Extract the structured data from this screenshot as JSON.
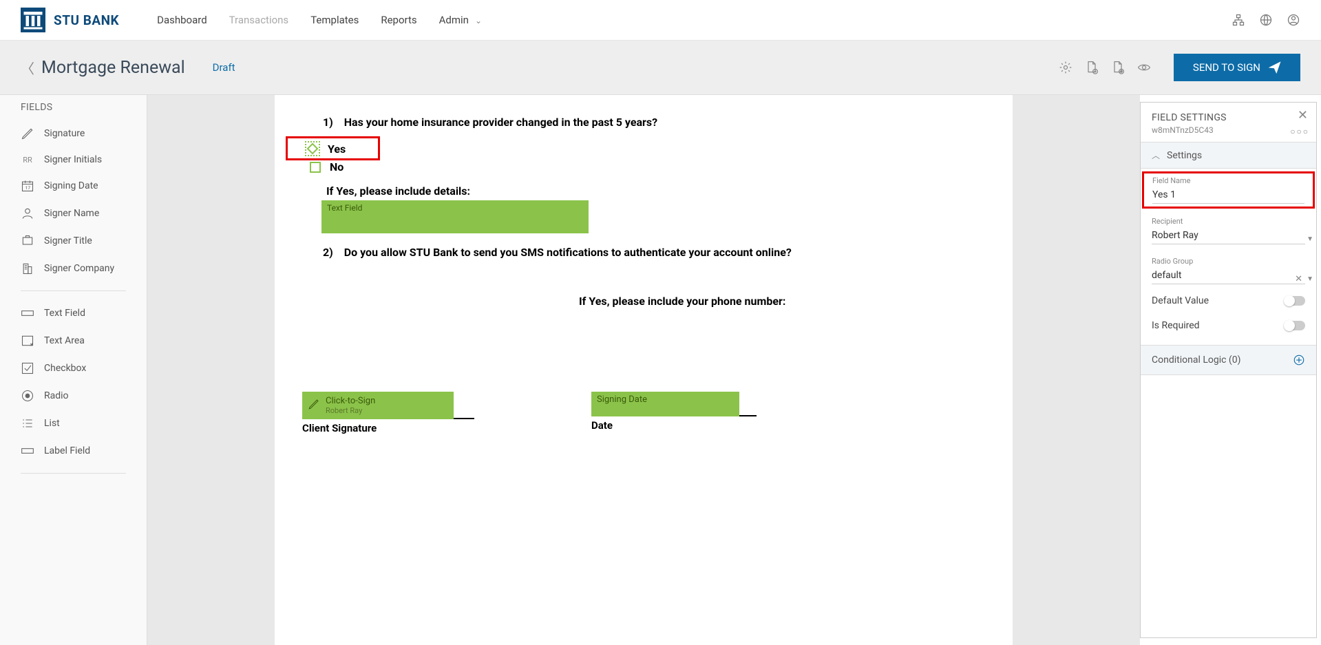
{
  "brand": "STU BANK",
  "nav": {
    "dashboard": "Dashboard",
    "transactions": "Transactions",
    "templates": "Templates",
    "reports": "Reports",
    "admin": "Admin"
  },
  "page": {
    "title": "Mortgage Renewal",
    "status": "Draft",
    "sendButton": "SEND TO SIGN"
  },
  "sidebar": {
    "title": "FIELDS",
    "signature": "Signature",
    "initialsPrefix": "RR",
    "initials": "Signer Initials",
    "signingDate": "Signing Date",
    "signerName": "Signer Name",
    "signerTitle": "Signer Title",
    "signerCompany": "Signer Company",
    "textField": "Text Field",
    "textArea": "Text Area",
    "checkbox": "Checkbox",
    "radio": "Radio",
    "list": "List",
    "labelField": "Label Field"
  },
  "doc": {
    "q1": "1)    Has your home insurance provider changed in the past 5 years?",
    "yes": "Yes",
    "no": "No",
    "ifYes1": "If Yes, please include details:",
    "textFieldLabel": "Text Field",
    "q2": "2)    Do you allow STU Bank to send you SMS notifications to authenticate your account online?",
    "ifYes2": "If Yes, please include your phone number:",
    "sigLabel": "Click-to-Sign",
    "sigSubtitle": "Robert Ray",
    "sigCaption": "Client Signature",
    "dateLabel": "Signing Date",
    "dateCaption": "Date"
  },
  "panel": {
    "title": "FIELD SETTINGS",
    "id": "w8mNTnzD5C43",
    "settingsSection": "Settings",
    "fieldNameLabel": "Field Name",
    "fieldNameValue": "Yes 1",
    "recipientLabel": "Recipient",
    "recipientValue": "Robert Ray",
    "radioGroupLabel": "Radio Group",
    "radioGroupValue": "default",
    "defaultValue": "Default Value",
    "isRequired": "Is Required",
    "condLogic": "Conditional Logic (0)"
  }
}
